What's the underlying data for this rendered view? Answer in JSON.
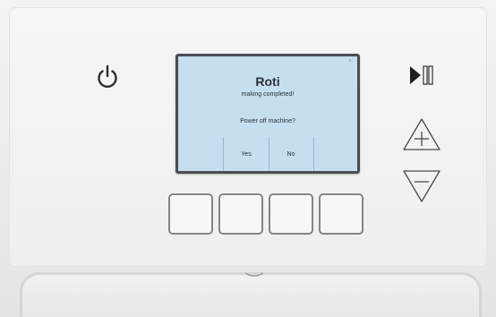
{
  "screen": {
    "close_glyph": "×",
    "title": "Roti",
    "status": "making completed!",
    "question": "Power off machine?",
    "buttons": [
      {
        "label": "Yes"
      },
      {
        "label": "No"
      }
    ]
  },
  "icons": {
    "power": "power-icon",
    "play_pause": "play-pause-icon",
    "increase": "plus-triangle-icon",
    "decrease": "minus-triangle-icon"
  },
  "colors": {
    "screen_background": "#c5def0",
    "screen_bezel": "#4a4d52",
    "panel": "#f1f1f1",
    "key_border": "#858585"
  }
}
